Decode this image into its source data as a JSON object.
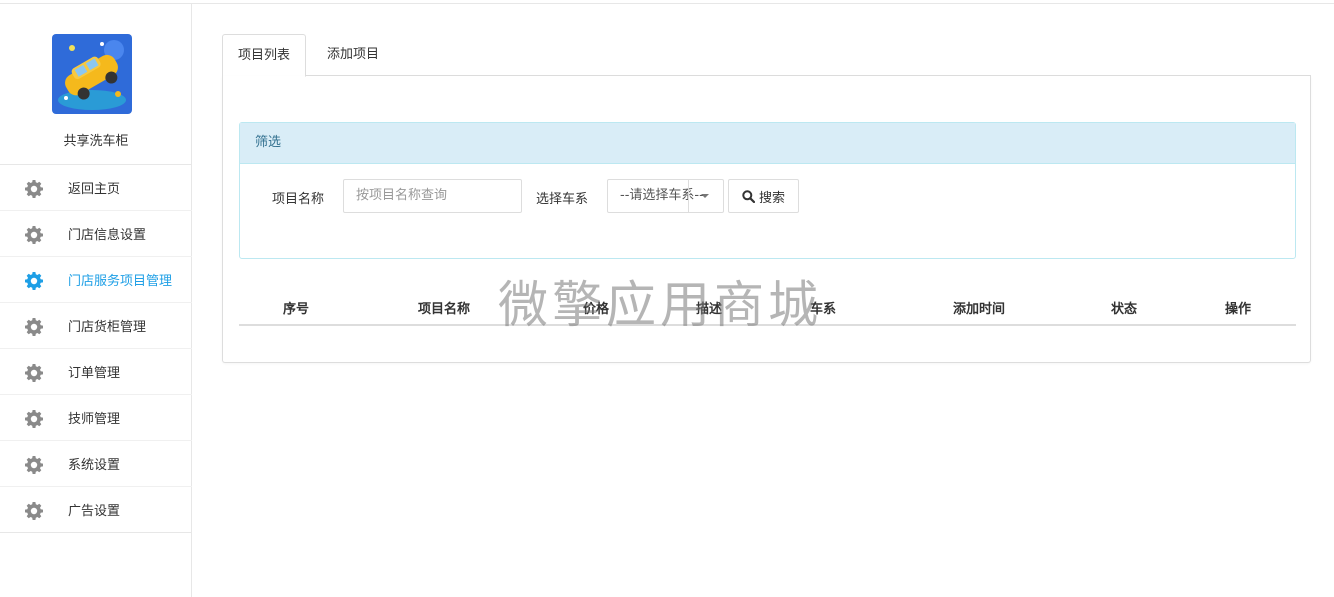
{
  "sidebar": {
    "shop_name": "共享洗车柜",
    "items": [
      {
        "label": "返回主页",
        "active": false
      },
      {
        "label": "门店信息设置",
        "active": false
      },
      {
        "label": "门店服务项目管理",
        "active": true
      },
      {
        "label": "门店货柜管理",
        "active": false
      },
      {
        "label": "订单管理",
        "active": false
      },
      {
        "label": "技师管理",
        "active": false
      },
      {
        "label": "系统设置",
        "active": false
      },
      {
        "label": "广告设置",
        "active": false
      }
    ]
  },
  "tabs": [
    {
      "label": "项目列表",
      "active": true
    },
    {
      "label": "添加项目",
      "active": false
    }
  ],
  "filter": {
    "title": "筛选",
    "name_label": "项目名称",
    "name_placeholder": "按项目名称查询",
    "series_label": "选择车系",
    "series_selected": "--请选择车系--",
    "search_label": "搜索"
  },
  "table": {
    "columns": [
      "序号",
      "项目名称",
      "价格",
      "描述",
      "车系",
      "添加时间",
      "状态",
      "操作"
    ]
  },
  "watermark": "微擎应用商城",
  "colors": {
    "accent": "#1e9fe6",
    "filter_head_bg": "#d9edf7",
    "filter_head_text": "#31708f"
  }
}
